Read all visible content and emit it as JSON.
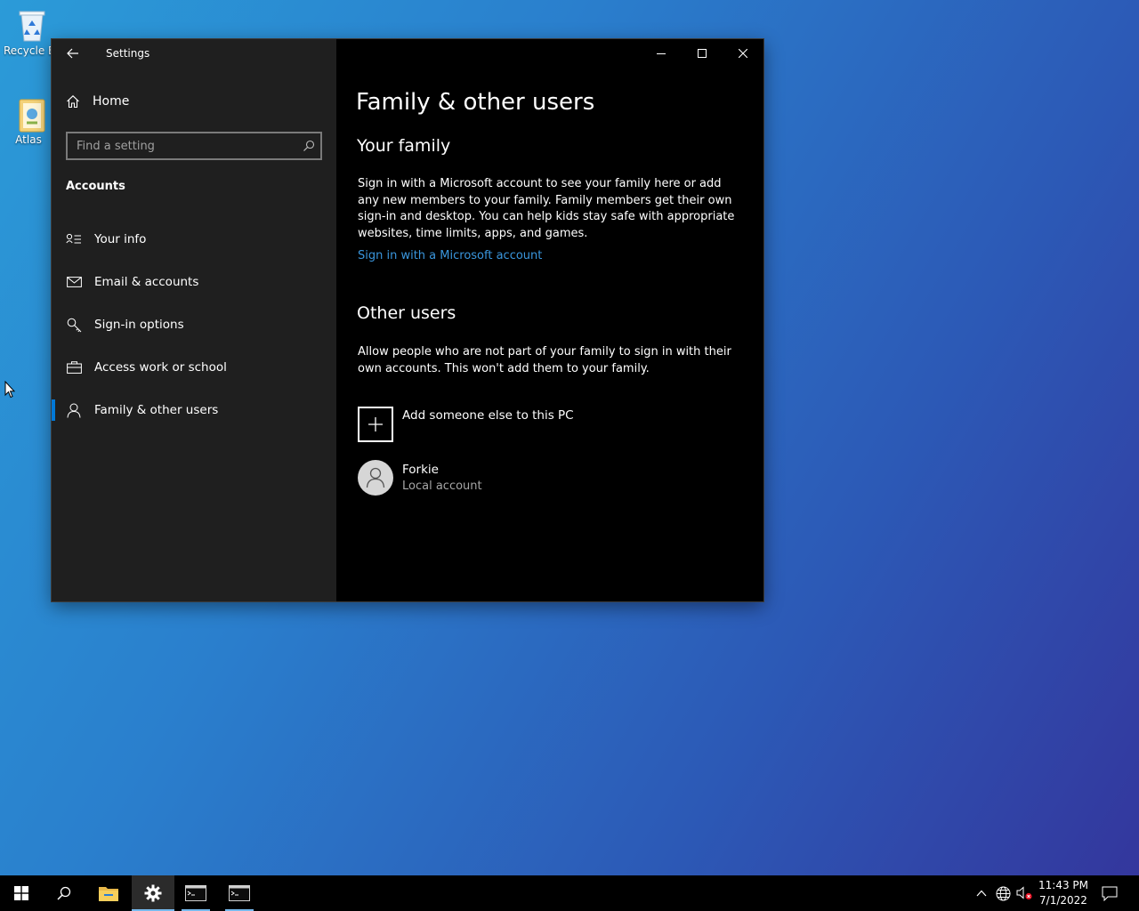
{
  "desktop": {
    "icons": [
      {
        "label": "Recycle Bin"
      },
      {
        "label": "Atlas"
      }
    ]
  },
  "window": {
    "title": "Settings",
    "controls": {
      "minimize": "minimize",
      "maximize": "maximize",
      "close": "close"
    }
  },
  "sidebar": {
    "home_label": "Home",
    "search_placeholder": "Find a setting",
    "section": "Accounts",
    "items": [
      {
        "label": "Your info",
        "icon": "contact-info-icon"
      },
      {
        "label": "Email & accounts",
        "icon": "mail-icon"
      },
      {
        "label": "Sign-in options",
        "icon": "key-icon"
      },
      {
        "label": "Access work or school",
        "icon": "briefcase-icon"
      },
      {
        "label": "Family & other users",
        "icon": "person-icon",
        "active": true
      }
    ]
  },
  "main": {
    "title": "Family & other users",
    "family": {
      "heading": "Your family",
      "description": "Sign in with a Microsoft account to see your family here or add any new members to your family. Family members get their own sign-in and desktop. You can help kids stay safe with appropriate websites, time limits, apps, and games.",
      "link": "Sign in with a Microsoft account"
    },
    "other_users": {
      "heading": "Other users",
      "description": "Allow people who are not part of your family to sign in with their own accounts. This won't add them to your family.",
      "add_label": "Add someone else to this PC",
      "users": [
        {
          "name": "Forkie",
          "type": "Local account"
        }
      ]
    }
  },
  "taskbar": {
    "time": "11:43 PM",
    "date": "7/1/2022"
  },
  "colors": {
    "accent": "#0078d7",
    "link": "#3a96dd",
    "sidebar_bg": "#1f1f1f",
    "content_bg": "#000000"
  }
}
